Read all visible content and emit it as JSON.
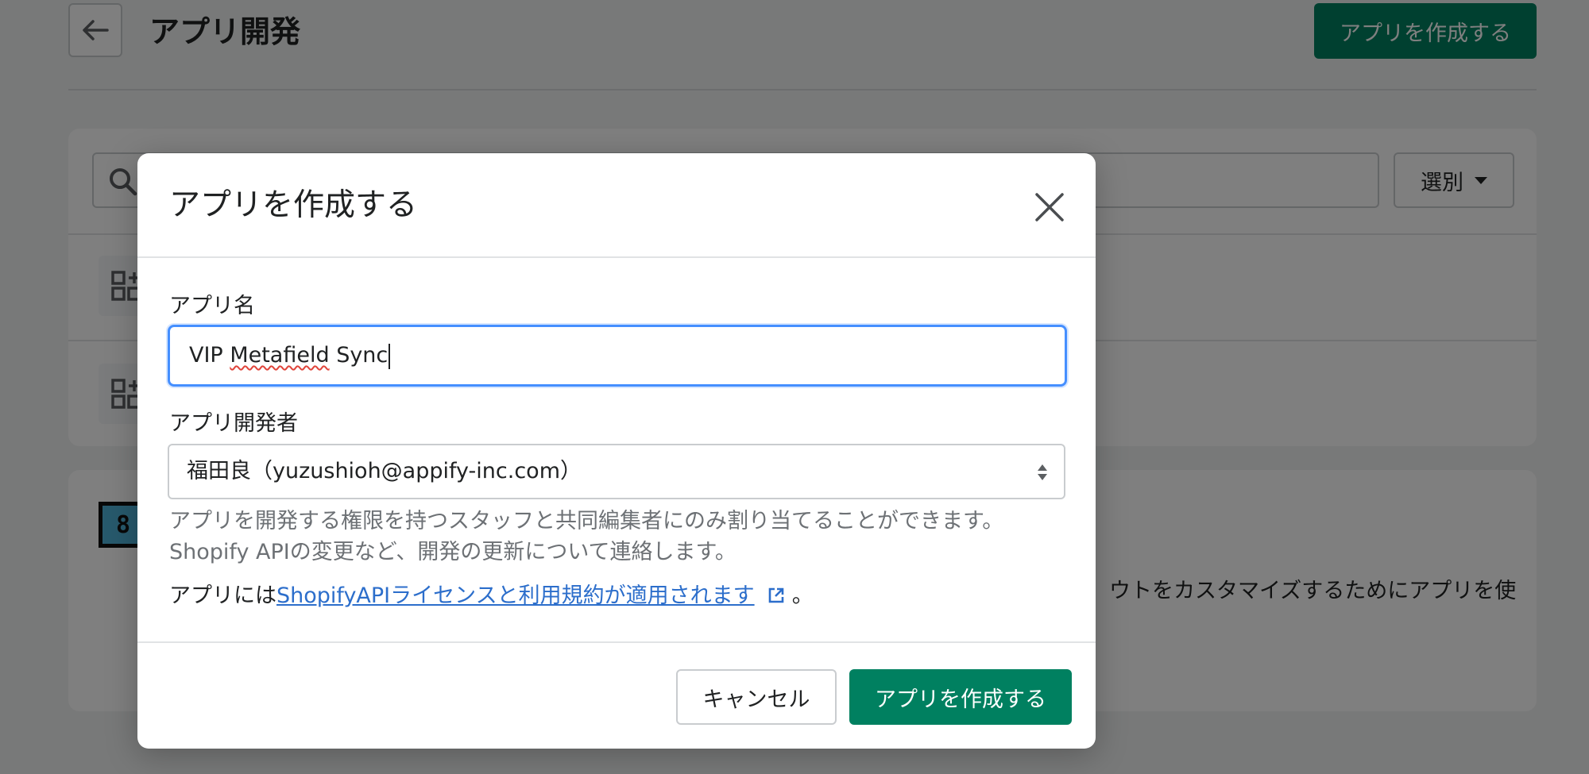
{
  "page": {
    "title": "アプリ開発",
    "create_button_label": "アプリを作成する",
    "filter_select_label": "選別",
    "card_text": "ウトをカスタマイズするためにアプリを使"
  },
  "modal": {
    "title": "アプリを作成する",
    "app_name_label": "アプリ名",
    "app_name_value_a": "VIP ",
    "app_name_value_b": "Metafield",
    "app_name_value_c": " Sync",
    "developer_label": "アプリ開発者",
    "developer_value": "福田良（yuzushioh@appify-inc.com）",
    "help_line_1": "アプリを開発する権限を持つスタッフと共同編集者にのみ割り当てることができます。",
    "help_line_2": "Shopify APIの変更など、開発の更新について連絡します。",
    "license_prefix": "アプリには",
    "license_link": "ShopifyAPIライセンスと利用規約が適用されます",
    "license_suffix": "。",
    "cancel_label": "キャンセル",
    "create_label": "アプリを作成する"
  },
  "colors": {
    "primary": "#008060",
    "focus": "#458fff",
    "link": "#2c6ecb"
  },
  "icons": [
    "back-arrow-icon",
    "search-icon",
    "caret-down-icon",
    "apps-icon",
    "close-icon",
    "select-arrows-icon",
    "external-link-icon"
  ]
}
